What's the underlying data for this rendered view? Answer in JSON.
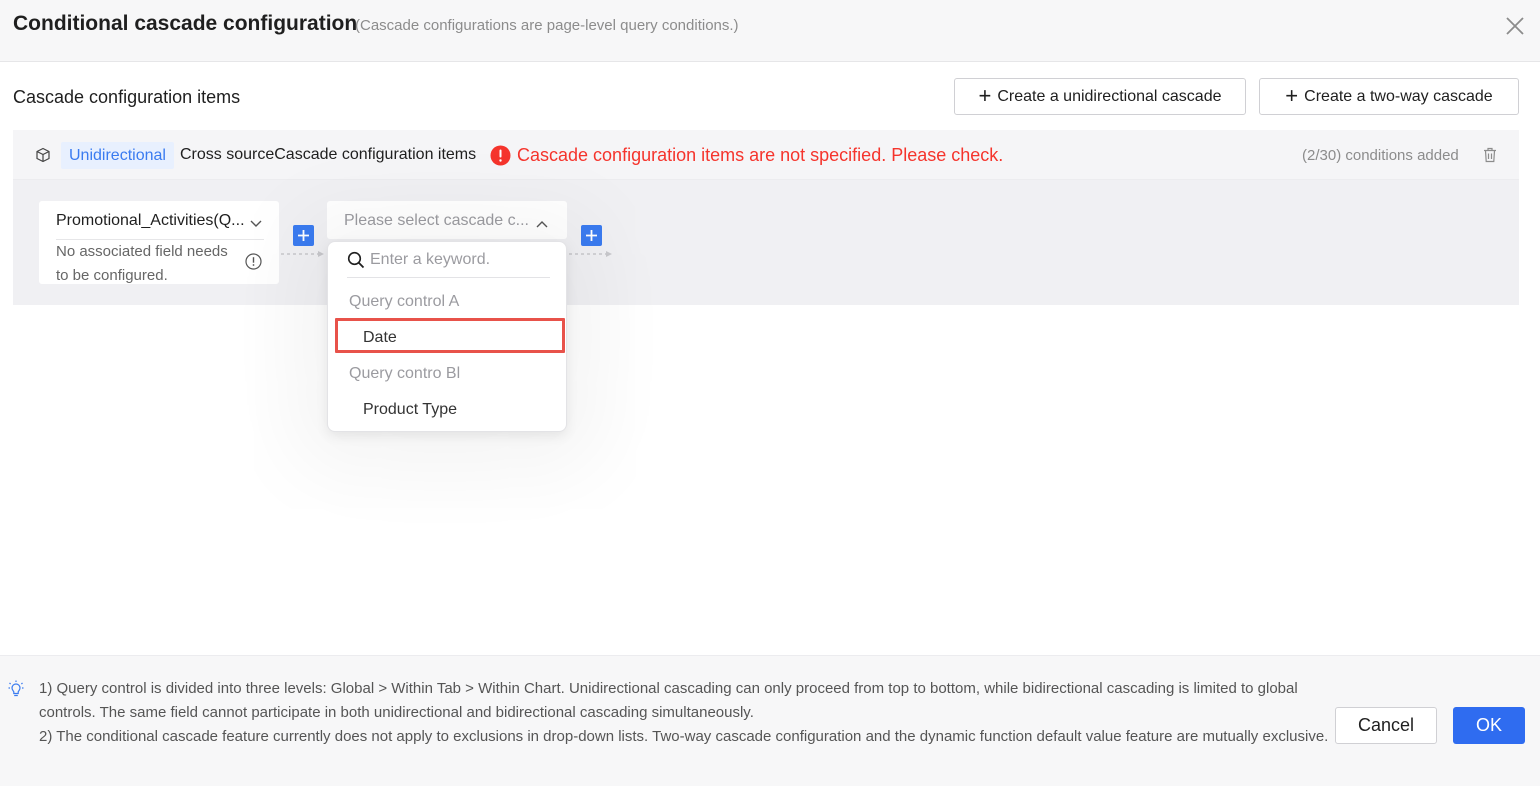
{
  "dialog": {
    "title": "Conditional cascade configuration",
    "subtitle": "(Cascade configurations are page-level query conditions.)"
  },
  "section": {
    "title": "Cascade configuration items",
    "create_unidirectional_label": "Create a unidirectional cascade",
    "create_two_way_label": "Create a two-way cascade"
  },
  "cascade_item": {
    "type_tag": "Unidirectional",
    "name": "Cross sourceCascade configuration items",
    "error_message": "Cascade configuration items are not specified. Please check.",
    "conditions_count": "(2/30) conditions added",
    "source": {
      "selected_value": "Promotional_Activities(Q...",
      "note": "No associated field needs to be configured."
    },
    "target": {
      "placeholder": "Please select cascade c..."
    }
  },
  "dropdown": {
    "search_placeholder": "Enter a keyword.",
    "groups": [
      {
        "label": "Query control A",
        "options": [
          "Date"
        ]
      },
      {
        "label": "Query contro Bl",
        "options": [
          "Product Type"
        ]
      }
    ]
  },
  "footer": {
    "notes": [
      "1) Query control is divided into three levels: Global > Within Tab > Within Chart. Unidirectional cascading can only proceed from top to bottom, while bidirectional cascading is limited to global controls. The same field cannot participate in both unidirectional and bidirectional cascading simultaneously.",
      "2) The conditional cascade feature currently does not apply to exclusions in drop-down lists. Two-way cascade configuration and the dynamic function default value feature are mutually exclusive."
    ],
    "cancel_label": "Cancel",
    "ok_label": "OK"
  },
  "colors": {
    "accent": "#2f6cf0",
    "error": "#f5342c",
    "highlight_outline": "#e8524a",
    "tag_background": "#e8f0fe"
  }
}
